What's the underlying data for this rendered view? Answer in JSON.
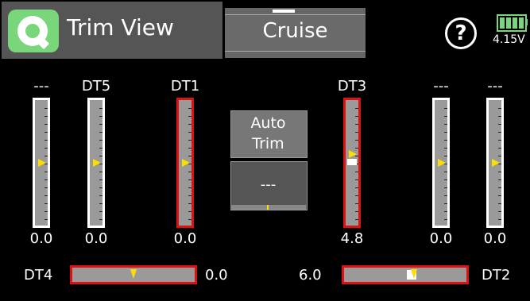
{
  "header": {
    "title": "Trim View",
    "mode": "Cruise",
    "app_icon": "app-logo-icon",
    "help_icon": "help-icon",
    "help_glyph": "?",
    "battery_icon": "battery-icon",
    "battery_voltage": "4.15V",
    "battery_level": 1.0
  },
  "vertical_trims": [
    {
      "label": "---",
      "value": "0.0",
      "position": 0.5,
      "active": false
    },
    {
      "label": "DT5",
      "value": "0.0",
      "position": 0.5,
      "active": false
    },
    {
      "label": "DT1",
      "value": "0.0",
      "position": 0.5,
      "active": true
    },
    {
      "label": "DT3",
      "value": "4.8",
      "position": 0.43,
      "active": true
    },
    {
      "label": "---",
      "value": "0.0",
      "position": 0.5,
      "active": false
    },
    {
      "label": "---",
      "value": "0.0",
      "position": 0.5,
      "active": false
    }
  ],
  "auto_trim": {
    "label_line1": "Auto",
    "label_line2": "Trim",
    "value": "---"
  },
  "horizontal_trims": [
    {
      "label": "DT4",
      "value": "0.0",
      "position": 0.5
    },
    {
      "label": "DT2",
      "value": "6.0",
      "position": 0.57
    }
  ],
  "colors": {
    "accent": "#7ad67a",
    "active_border": "#d11111",
    "marker": "#ffdd00"
  }
}
